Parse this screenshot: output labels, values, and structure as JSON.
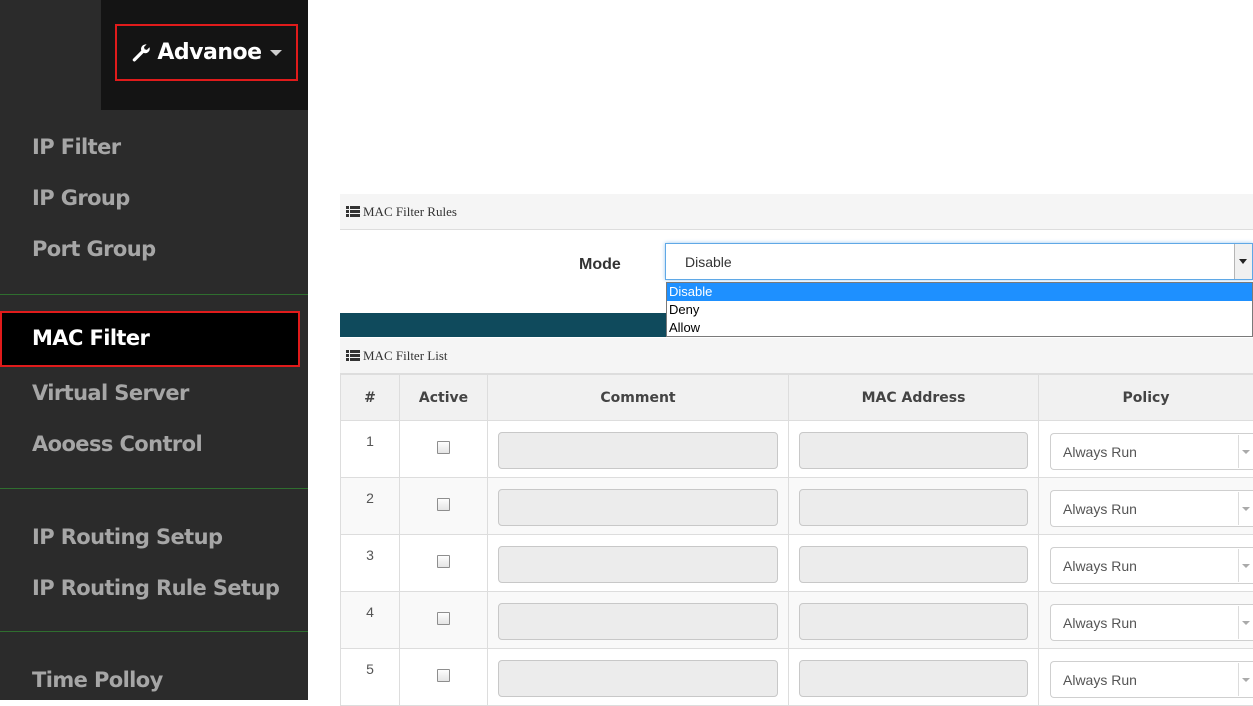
{
  "sidebar": {
    "menu_button": {
      "label": "Advanoe",
      "icon": "wrench-icon"
    },
    "items": [
      {
        "label": "IP Filter"
      },
      {
        "label": "IP Group"
      },
      {
        "label": "Port Group"
      },
      {
        "label": "MAC Filter",
        "active": true
      },
      {
        "label": "Virtual Server"
      },
      {
        "label": "Aooess Control"
      },
      {
        "label": "IP Routing Setup"
      },
      {
        "label": "IP Routing Rule Setup"
      },
      {
        "label": "Time Polloy"
      }
    ]
  },
  "rules_section": {
    "title": "MAC Filter Rules",
    "mode_label": "Mode",
    "mode_value": "Disable",
    "mode_options": [
      "Disable",
      "Deny",
      "Allow"
    ],
    "highlighted_option": "Disable"
  },
  "list_section": {
    "title": "MAC Filter List",
    "columns": [
      "#",
      "Active",
      "Comment",
      "MAC Address",
      "Policy"
    ],
    "rows": [
      {
        "num": "1",
        "active": false,
        "comment": "",
        "mac": "",
        "policy": "Always Run"
      },
      {
        "num": "2",
        "active": false,
        "comment": "",
        "mac": "",
        "policy": "Always Run"
      },
      {
        "num": "3",
        "active": false,
        "comment": "",
        "mac": "",
        "policy": "Always Run"
      },
      {
        "num": "4",
        "active": false,
        "comment": "",
        "mac": "",
        "policy": "Always Run"
      },
      {
        "num": "5",
        "active": false,
        "comment": "",
        "mac": "",
        "policy": "Always Run"
      }
    ]
  },
  "colors": {
    "sidebar_bg": "#2b2b2b",
    "highlight_border": "#e01b1b",
    "divider": "#2f6e2f",
    "teal_bar": "#0f4a5c",
    "option_selected": "#1e90ff"
  }
}
